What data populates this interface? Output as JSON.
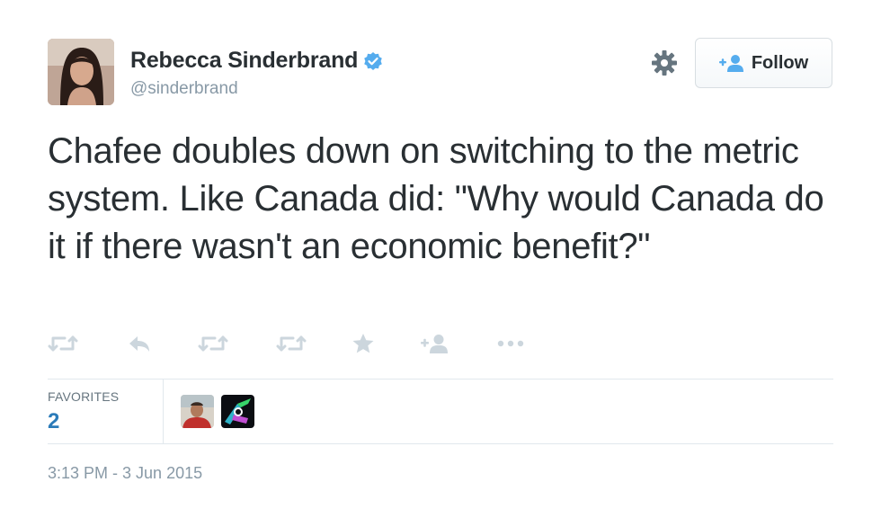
{
  "author": {
    "display_name": "Rebecca Sinderbrand",
    "handle": "@sinderbrand",
    "verified": true
  },
  "header": {
    "follow_label": "Follow"
  },
  "tweet": {
    "text": "Chafee doubles down on switching to the metric system. Like Canada did: \"Why would Canada do it if there wasn't an economic benefit?\""
  },
  "actions": [
    {
      "name": "retweet-icon"
    },
    {
      "name": "reply-icon"
    },
    {
      "name": "retweet-icon"
    },
    {
      "name": "retweet-icon"
    },
    {
      "name": "star-icon"
    },
    {
      "name": "follow-user-icon"
    },
    {
      "name": "more-icon"
    }
  ],
  "stats": {
    "favorites_label": "FAVORITES",
    "favorites_count": "2"
  },
  "timestamp": "3:13 PM - 3 Jun 2015",
  "colors": {
    "text": "#292f33",
    "muted": "#8899a6",
    "link": "#2b7bb9",
    "verified": "#55acee",
    "icon": "#ccd6dd",
    "border": "#e1e8ed"
  }
}
